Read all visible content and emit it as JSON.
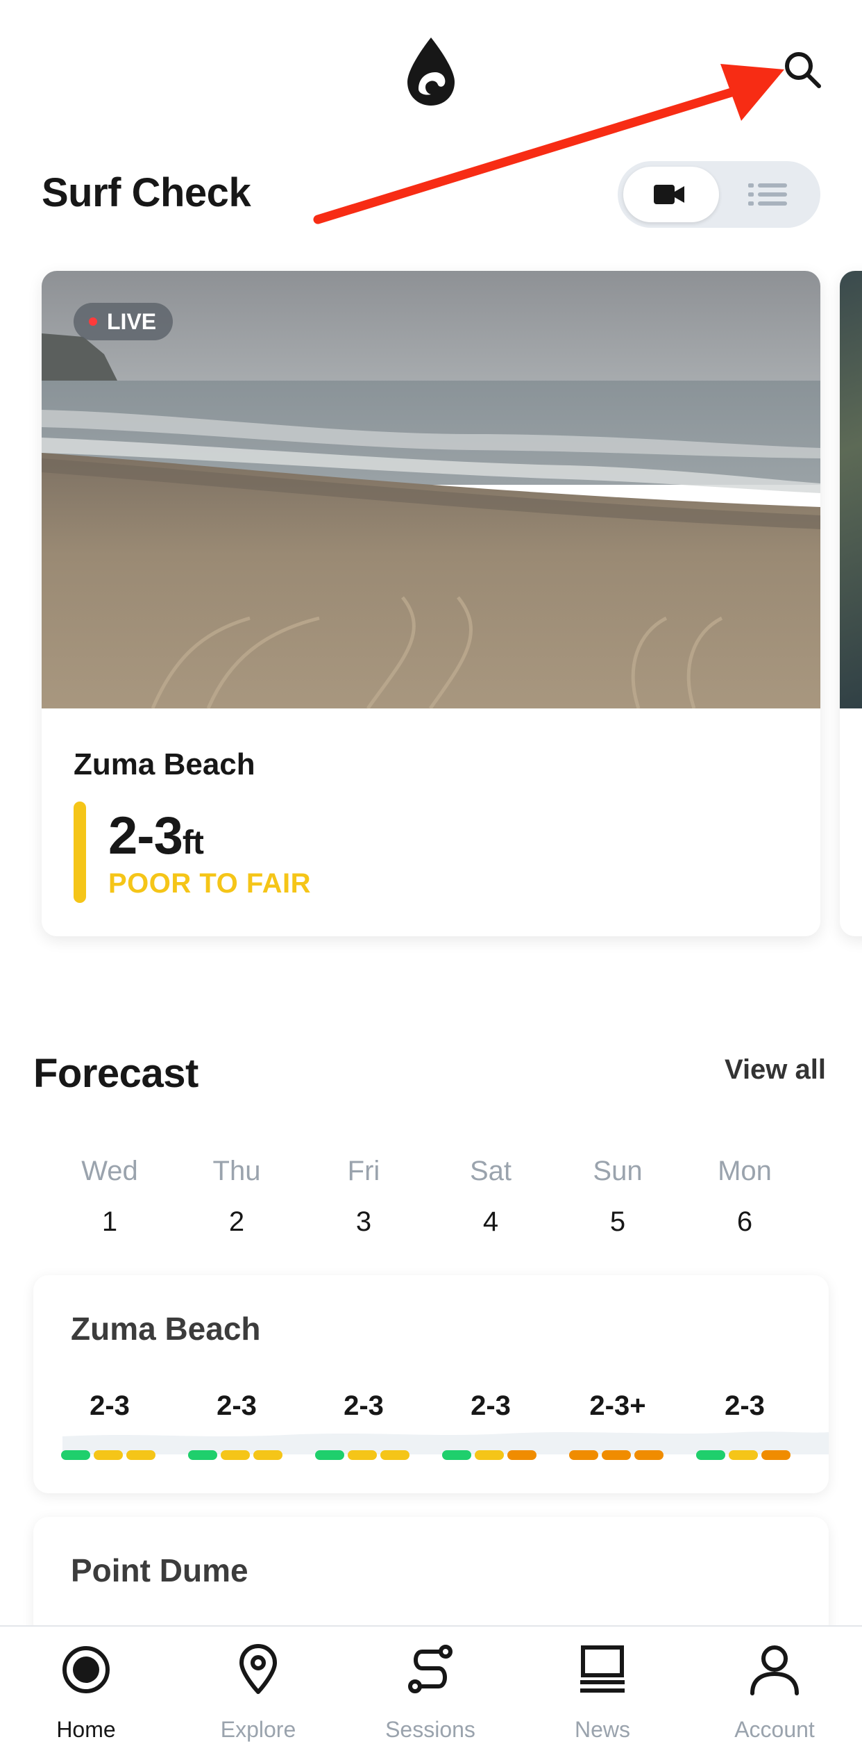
{
  "header": {
    "logo_icon": "water-drop-logo-icon",
    "search_icon": "search-icon"
  },
  "surf_check": {
    "title": "Surf Check",
    "view_toggle": {
      "options": [
        "camera-icon",
        "list-icon"
      ],
      "selected": "camera-icon"
    },
    "cams": [
      {
        "live_label": "LIVE",
        "spot_name": "Zuma Beach",
        "height": "2-3",
        "height_unit": "ft",
        "rating": "POOR TO FAIR",
        "rating_color": "#f5c518"
      }
    ]
  },
  "forecast": {
    "title": "Forecast",
    "view_all_label": "View all",
    "days": [
      {
        "name": "Wed",
        "num": "1"
      },
      {
        "name": "Thu",
        "num": "2"
      },
      {
        "name": "Fri",
        "num": "3"
      },
      {
        "name": "Sat",
        "num": "4"
      },
      {
        "name": "Sun",
        "num": "5"
      },
      {
        "name": "Mon",
        "num": "6"
      }
    ],
    "spots": [
      {
        "name": "Zuma Beach",
        "values": [
          "2-3",
          "2-3",
          "2-3",
          "2-3",
          "2-3+",
          "2-3"
        ],
        "ratings": [
          [
            "#1fcf6c",
            "#f5c518",
            "#f5c518"
          ],
          [
            "#1fcf6c",
            "#f5c518",
            "#f5c518"
          ],
          [
            "#1fcf6c",
            "#f5c518",
            "#f5c518"
          ],
          [
            "#1fcf6c",
            "#f5c518",
            "#f08c00"
          ],
          [
            "#f08c00",
            "#f08c00",
            "#f08c00"
          ],
          [
            "#1fcf6c",
            "#f5c518",
            "#f08c00"
          ]
        ]
      },
      {
        "name": "Point Dume"
      }
    ]
  },
  "bottom_nav": {
    "items": [
      {
        "label": "Home",
        "icon": "home-icon",
        "active": true
      },
      {
        "label": "Explore",
        "icon": "map-pin-icon",
        "active": false
      },
      {
        "label": "Sessions",
        "icon": "sessions-icon",
        "active": false
      },
      {
        "label": "News",
        "icon": "news-icon",
        "active": false
      },
      {
        "label": "Account",
        "icon": "account-icon",
        "active": false
      }
    ]
  },
  "colors": {
    "accent_arrow": "#f72c14",
    "rating_green": "#1fcf6c",
    "rating_yellow": "#f5c518",
    "rating_orange": "#f08c00",
    "muted_text": "#9aa3ad"
  }
}
